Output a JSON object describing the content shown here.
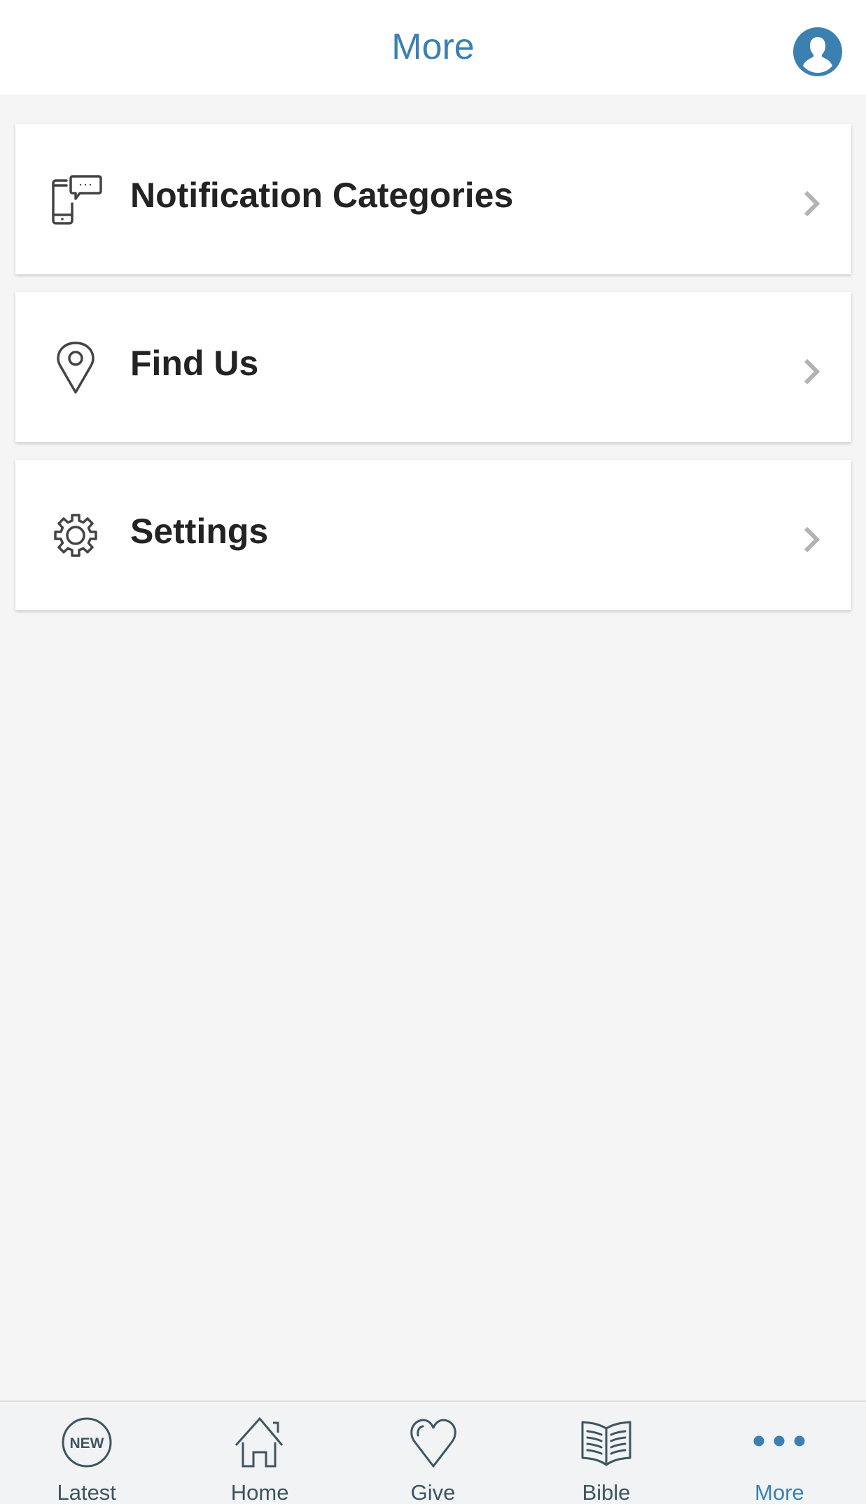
{
  "header": {
    "title": "More",
    "avatar_icon": "user-avatar-icon"
  },
  "colors": {
    "accent": "#3b80b1",
    "icon_dark": "#3d5560",
    "text_primary": "#232323",
    "chevron": "#b3b3b3",
    "background": "#f5f5f5"
  },
  "menu": {
    "items": [
      {
        "label": "Notification Categories",
        "icon": "phone-message-icon"
      },
      {
        "label": "Find Us",
        "icon": "map-pin-icon"
      },
      {
        "label": "Settings",
        "icon": "gear-icon"
      }
    ]
  },
  "tabs": {
    "items": [
      {
        "label": "Latest",
        "icon": "new-badge-icon",
        "icon_text": "NEW",
        "active": false
      },
      {
        "label": "Home",
        "icon": "home-icon",
        "active": false
      },
      {
        "label": "Give",
        "icon": "heart-icon",
        "active": false
      },
      {
        "label": "Bible",
        "icon": "open-book-icon",
        "active": false
      },
      {
        "label": "More",
        "icon": "more-dots-icon",
        "active": true
      }
    ]
  }
}
